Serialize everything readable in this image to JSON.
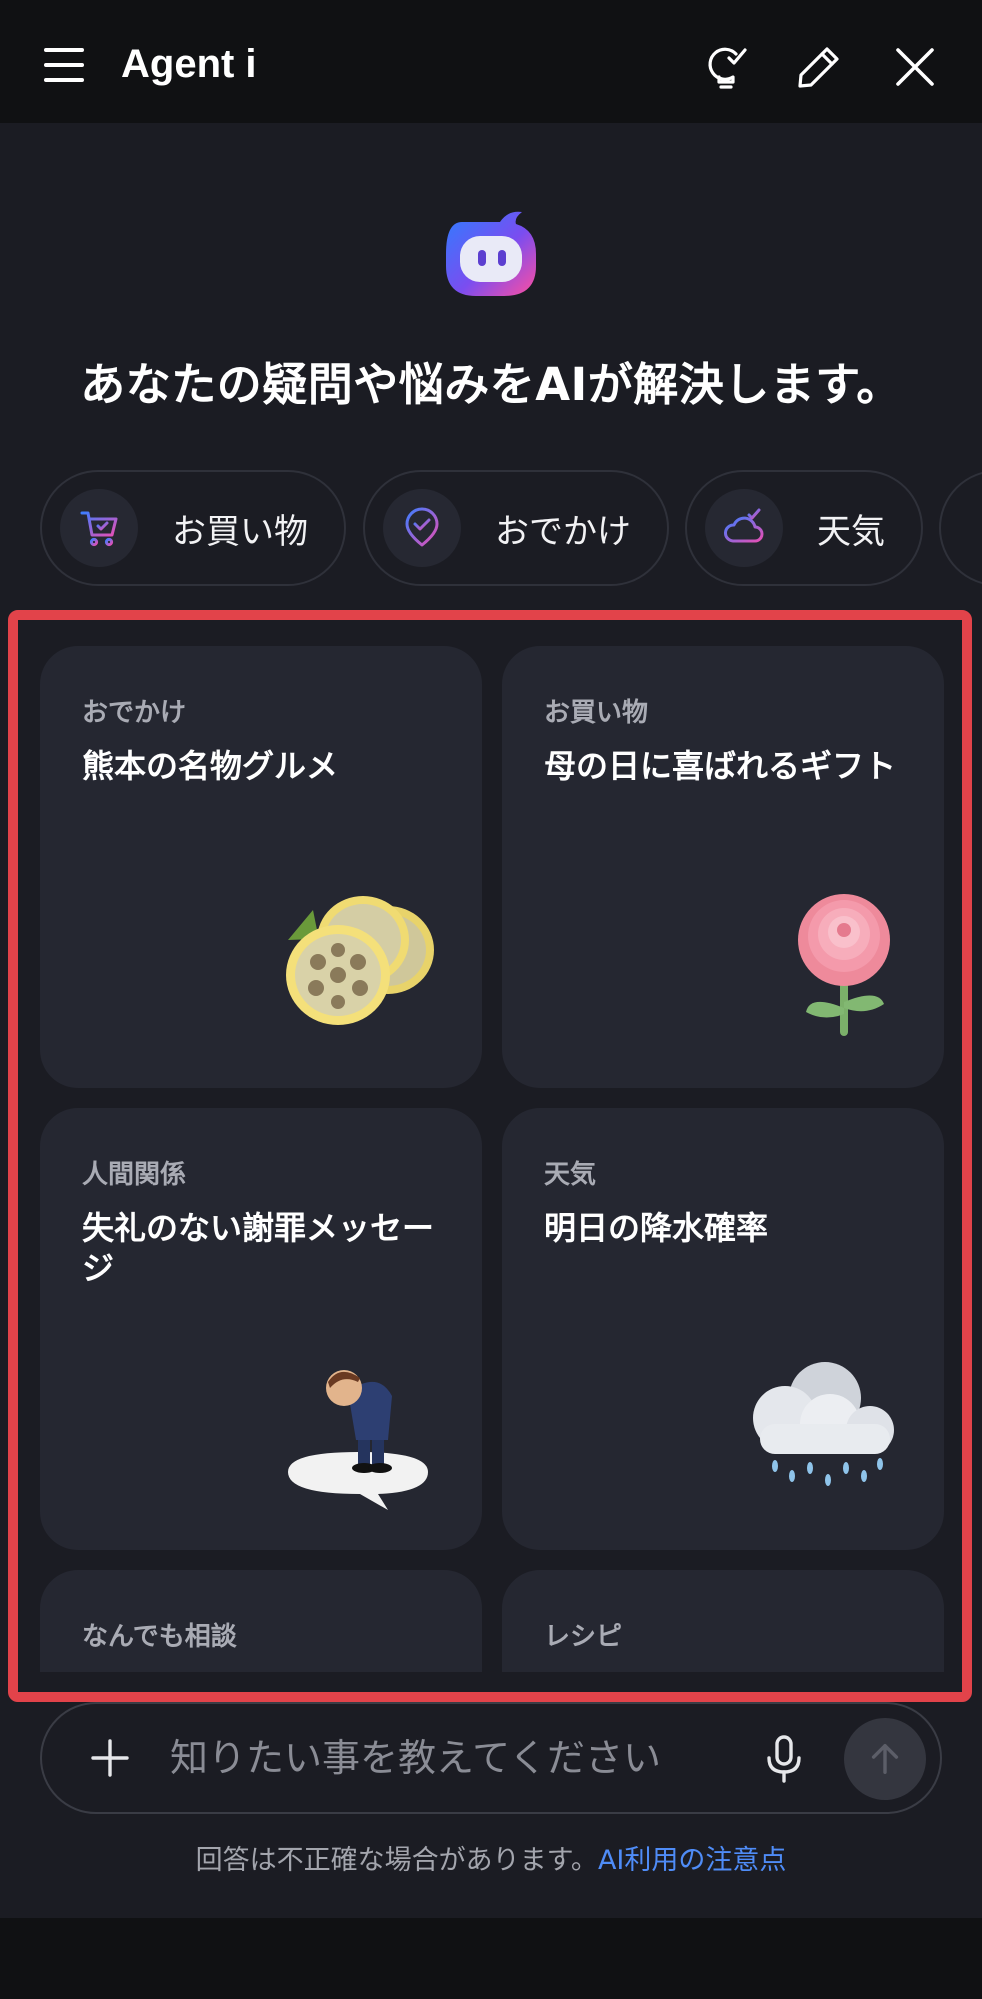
{
  "header": {
    "title": "Agent i",
    "icons": [
      "menu-icon",
      "lightbulb-check-icon",
      "pencil-icon",
      "close-icon"
    ]
  },
  "hero": {
    "headline": "あなたの疑問や悩みをAIが解決します。"
  },
  "chips": [
    {
      "label": "お買い物",
      "icon": "cart-icon"
    },
    {
      "label": "おでかけ",
      "icon": "location-check-icon"
    },
    {
      "label": "天気",
      "icon": "cloud-sun-icon"
    }
  ],
  "cards": [
    {
      "category": "おでかけ",
      "title": "熊本の名物グルメ",
      "icon": "lotus-root-icon"
    },
    {
      "category": "お買い物",
      "title": "母の日に喜ばれるギフト",
      "icon": "carnation-icon"
    },
    {
      "category": "人間関係",
      "title": "失礼のない謝罪メッセージ",
      "icon": "bowing-man-icon"
    },
    {
      "category": "天気",
      "title": "明日の降水確率",
      "icon": "rain-cloud-icon"
    },
    {
      "category": "なんでも相談",
      "title": "",
      "icon": ""
    },
    {
      "category": "レシピ",
      "title": "",
      "icon": ""
    }
  ],
  "input": {
    "placeholder": "知りたい事を教えてください",
    "value": ""
  },
  "footer": {
    "disclaimer": "回答は不正確な場合があります。",
    "link": "AI利用の注意点"
  },
  "colors": {
    "background": "#1b1c23",
    "header": "#101113",
    "card": "#252731",
    "highlight": "#e2434a",
    "link": "#4f8cf7"
  }
}
